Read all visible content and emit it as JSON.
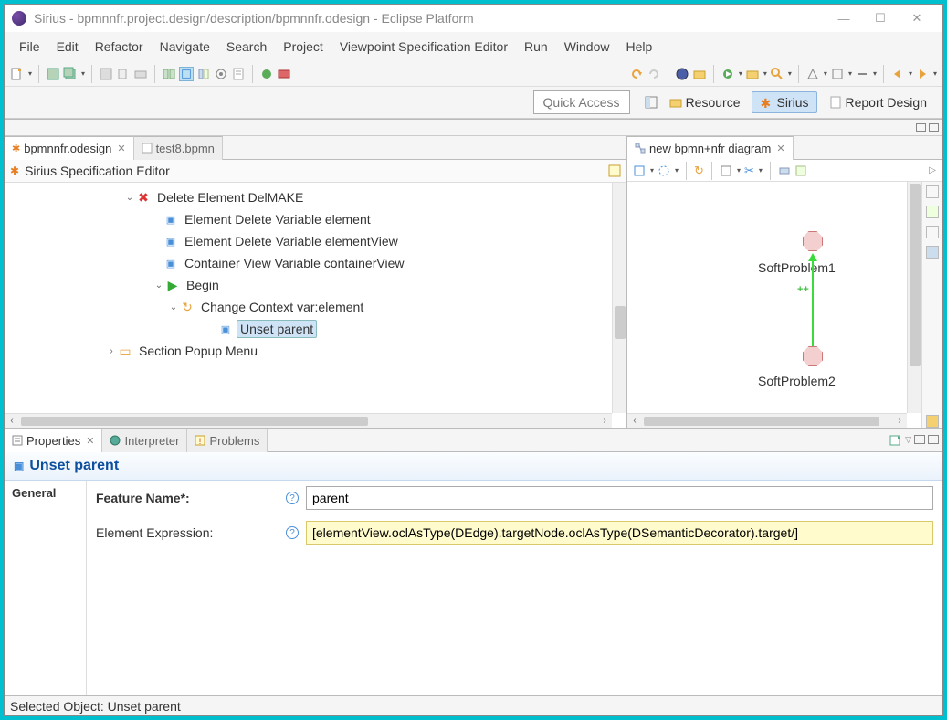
{
  "titlebar": {
    "text": "Sirius - bpmnnfr.project.design/description/bpmnnfr.odesign - Eclipse Platform"
  },
  "menubar": [
    "File",
    "Edit",
    "Refactor",
    "Navigate",
    "Search",
    "Project",
    "Viewpoint Specification Editor",
    "Run",
    "Window",
    "Help"
  ],
  "quick_access": "Quick Access",
  "perspectives": {
    "resource": "Resource",
    "sirius": "Sirius",
    "report": "Report Design"
  },
  "editor_tabs": {
    "active": "bpmnnfr.odesign",
    "inactive": "test8.bpmn"
  },
  "sirius_header": "Sirius Specification Editor",
  "tree": {
    "n0": "Delete Element DelMAKE",
    "n1": "Element Delete Variable element",
    "n2": "Element Delete Variable elementView",
    "n3": "Container View Variable containerView",
    "n4": "Begin",
    "n5": "Change Context var:element",
    "n6": "Unset parent",
    "n7": "Section Popup Menu"
  },
  "diagram_tab": "new bpmn+nfr diagram",
  "diagram": {
    "node1": "SoftProblem1",
    "node2": "SoftProblem2"
  },
  "prop_tabs": {
    "properties": "Properties",
    "interpreter": "Interpreter",
    "problems": "Problems"
  },
  "prop_title": "Unset parent",
  "prop_side": "General",
  "form": {
    "feature_label": "Feature Name*:",
    "feature_value": "parent",
    "expr_label": "Element Expression:",
    "expr_value": "[elementView.oclAsType(DEdge).targetNode.oclAsType(DSemanticDecorator).target/]"
  },
  "statusbar": "Selected Object: Unset parent"
}
